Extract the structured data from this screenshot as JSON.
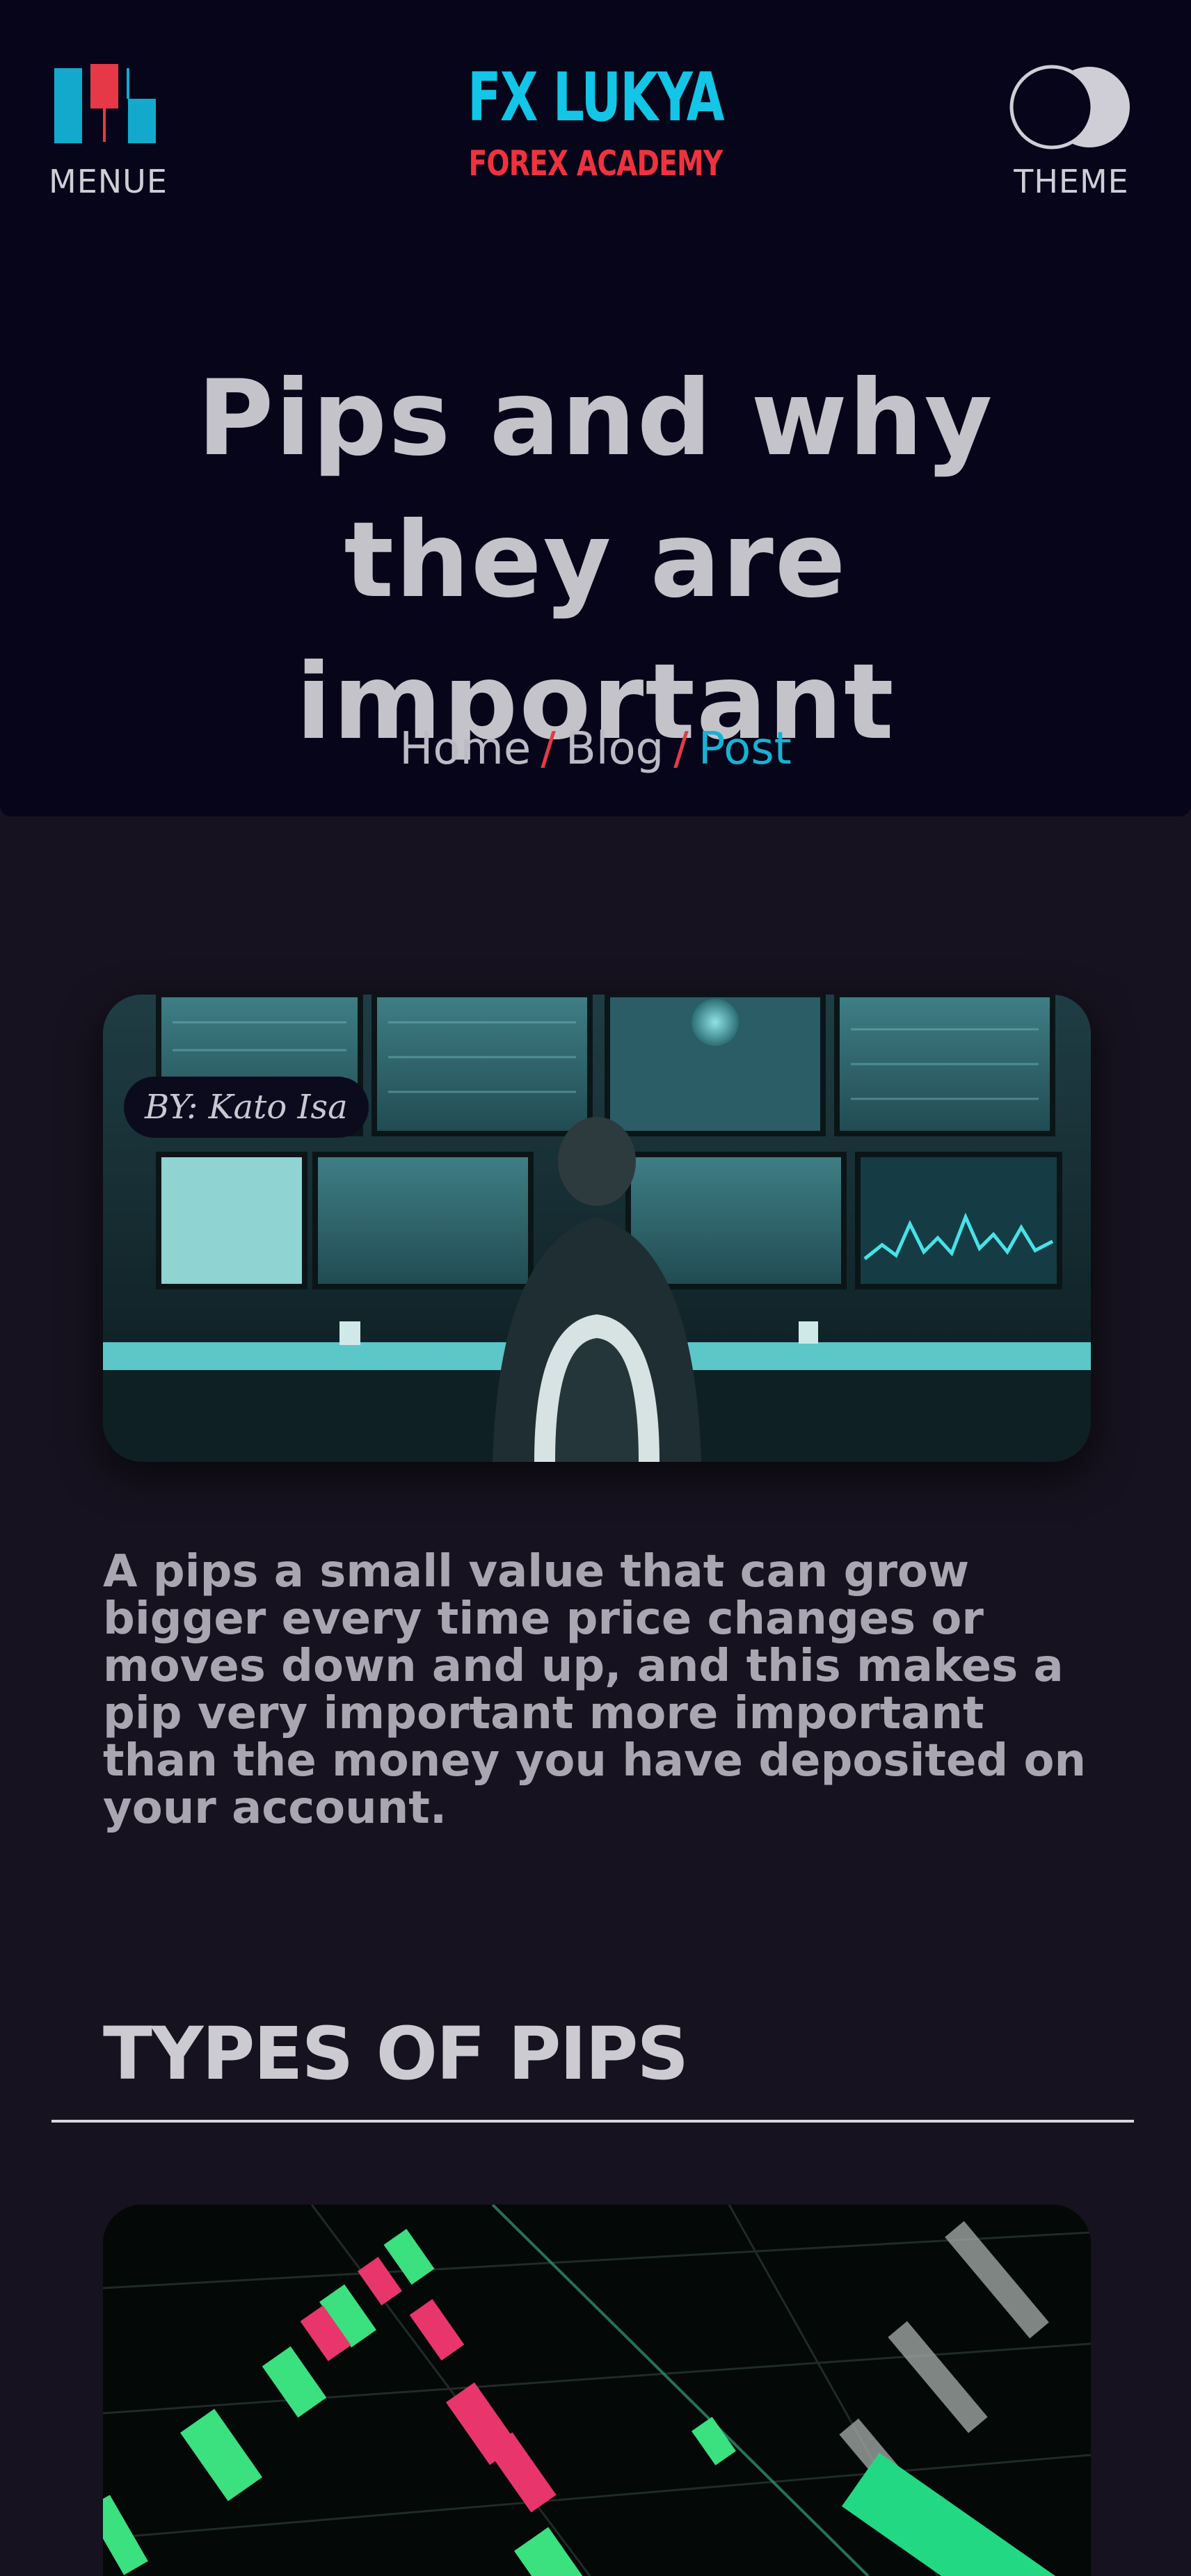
{
  "header": {
    "menu_label": "MENUE",
    "brand_title": "FX LUKYA",
    "brand_subtitle": "FOREX ACADEMY",
    "theme_label": "THEME"
  },
  "hero": {
    "title": "Pips and why they are important",
    "breadcrumb": {
      "home": "Home",
      "blog": "Blog",
      "current": "Post",
      "separator": "/"
    }
  },
  "article": {
    "author_badge": "BY: Kato Isa",
    "lead_paragraph": "A pips a small value that can grow bigger every time price changes or moves down and up, and this makes a pip very important more important than the money you have deposited on your account.",
    "section_heading": "TYPES OF PIPS"
  },
  "colors": {
    "accent_cyan": "#13c5e6",
    "accent_red": "#f0323f",
    "hero_background": "#070519",
    "page_background": "#16121f"
  },
  "icons": {
    "menu": "candlestick-menu-icon",
    "theme": "theme-toggle-icon"
  }
}
